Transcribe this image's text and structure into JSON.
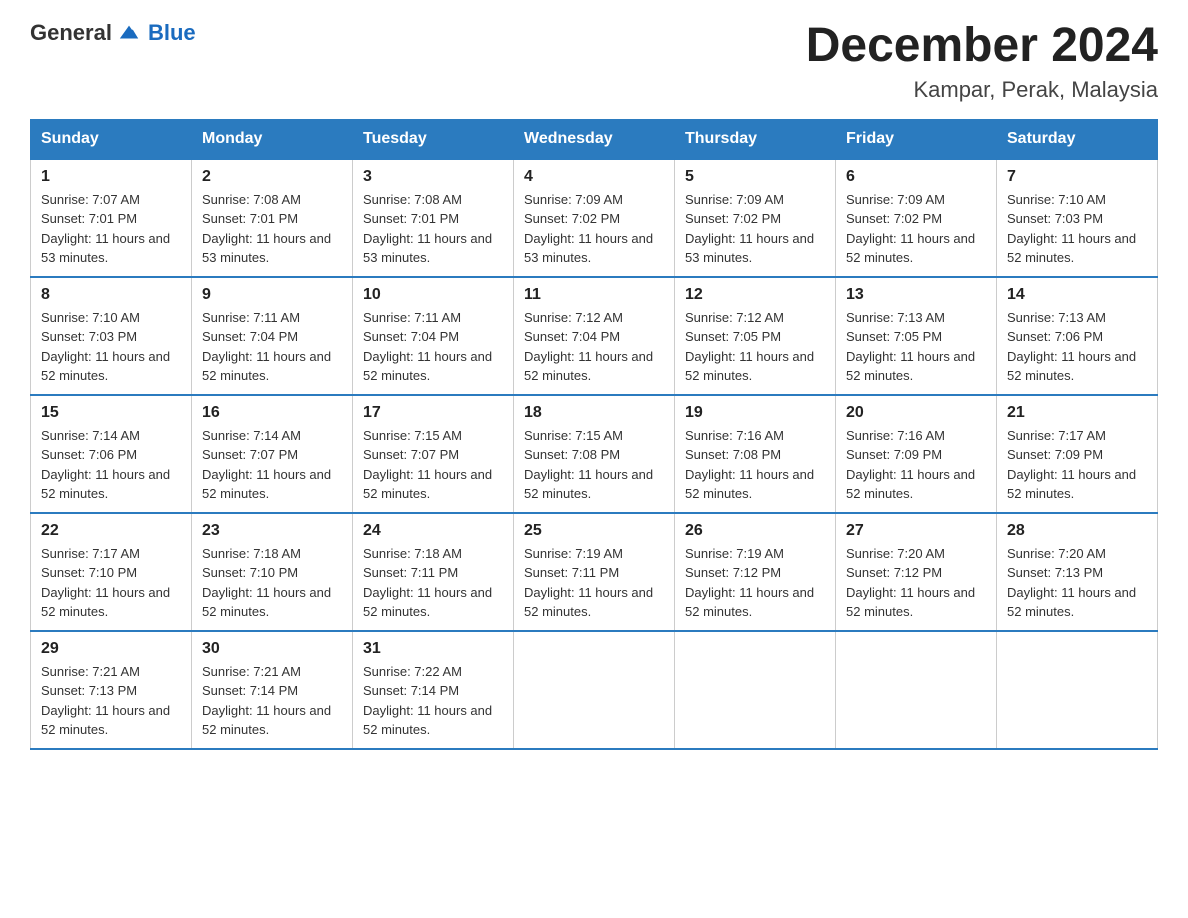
{
  "header": {
    "logo_general": "General",
    "logo_blue": "Blue",
    "month_title": "December 2024",
    "location": "Kampar, Perak, Malaysia"
  },
  "days_of_week": [
    "Sunday",
    "Monday",
    "Tuesday",
    "Wednesday",
    "Thursday",
    "Friday",
    "Saturday"
  ],
  "weeks": [
    [
      {
        "day": "1",
        "sunrise": "7:07 AM",
        "sunset": "7:01 PM",
        "daylight": "11 hours and 53 minutes."
      },
      {
        "day": "2",
        "sunrise": "7:08 AM",
        "sunset": "7:01 PM",
        "daylight": "11 hours and 53 minutes."
      },
      {
        "day": "3",
        "sunrise": "7:08 AM",
        "sunset": "7:01 PM",
        "daylight": "11 hours and 53 minutes."
      },
      {
        "day": "4",
        "sunrise": "7:09 AM",
        "sunset": "7:02 PM",
        "daylight": "11 hours and 53 minutes."
      },
      {
        "day": "5",
        "sunrise": "7:09 AM",
        "sunset": "7:02 PM",
        "daylight": "11 hours and 53 minutes."
      },
      {
        "day": "6",
        "sunrise": "7:09 AM",
        "sunset": "7:02 PM",
        "daylight": "11 hours and 52 minutes."
      },
      {
        "day": "7",
        "sunrise": "7:10 AM",
        "sunset": "7:03 PM",
        "daylight": "11 hours and 52 minutes."
      }
    ],
    [
      {
        "day": "8",
        "sunrise": "7:10 AM",
        "sunset": "7:03 PM",
        "daylight": "11 hours and 52 minutes."
      },
      {
        "day": "9",
        "sunrise": "7:11 AM",
        "sunset": "7:04 PM",
        "daylight": "11 hours and 52 minutes."
      },
      {
        "day": "10",
        "sunrise": "7:11 AM",
        "sunset": "7:04 PM",
        "daylight": "11 hours and 52 minutes."
      },
      {
        "day": "11",
        "sunrise": "7:12 AM",
        "sunset": "7:04 PM",
        "daylight": "11 hours and 52 minutes."
      },
      {
        "day": "12",
        "sunrise": "7:12 AM",
        "sunset": "7:05 PM",
        "daylight": "11 hours and 52 minutes."
      },
      {
        "day": "13",
        "sunrise": "7:13 AM",
        "sunset": "7:05 PM",
        "daylight": "11 hours and 52 minutes."
      },
      {
        "day": "14",
        "sunrise": "7:13 AM",
        "sunset": "7:06 PM",
        "daylight": "11 hours and 52 minutes."
      }
    ],
    [
      {
        "day": "15",
        "sunrise": "7:14 AM",
        "sunset": "7:06 PM",
        "daylight": "11 hours and 52 minutes."
      },
      {
        "day": "16",
        "sunrise": "7:14 AM",
        "sunset": "7:07 PM",
        "daylight": "11 hours and 52 minutes."
      },
      {
        "day": "17",
        "sunrise": "7:15 AM",
        "sunset": "7:07 PM",
        "daylight": "11 hours and 52 minutes."
      },
      {
        "day": "18",
        "sunrise": "7:15 AM",
        "sunset": "7:08 PM",
        "daylight": "11 hours and 52 minutes."
      },
      {
        "day": "19",
        "sunrise": "7:16 AM",
        "sunset": "7:08 PM",
        "daylight": "11 hours and 52 minutes."
      },
      {
        "day": "20",
        "sunrise": "7:16 AM",
        "sunset": "7:09 PM",
        "daylight": "11 hours and 52 minutes."
      },
      {
        "day": "21",
        "sunrise": "7:17 AM",
        "sunset": "7:09 PM",
        "daylight": "11 hours and 52 minutes."
      }
    ],
    [
      {
        "day": "22",
        "sunrise": "7:17 AM",
        "sunset": "7:10 PM",
        "daylight": "11 hours and 52 minutes."
      },
      {
        "day": "23",
        "sunrise": "7:18 AM",
        "sunset": "7:10 PM",
        "daylight": "11 hours and 52 minutes."
      },
      {
        "day": "24",
        "sunrise": "7:18 AM",
        "sunset": "7:11 PM",
        "daylight": "11 hours and 52 minutes."
      },
      {
        "day": "25",
        "sunrise": "7:19 AM",
        "sunset": "7:11 PM",
        "daylight": "11 hours and 52 minutes."
      },
      {
        "day": "26",
        "sunrise": "7:19 AM",
        "sunset": "7:12 PM",
        "daylight": "11 hours and 52 minutes."
      },
      {
        "day": "27",
        "sunrise": "7:20 AM",
        "sunset": "7:12 PM",
        "daylight": "11 hours and 52 minutes."
      },
      {
        "day": "28",
        "sunrise": "7:20 AM",
        "sunset": "7:13 PM",
        "daylight": "11 hours and 52 minutes."
      }
    ],
    [
      {
        "day": "29",
        "sunrise": "7:21 AM",
        "sunset": "7:13 PM",
        "daylight": "11 hours and 52 minutes."
      },
      {
        "day": "30",
        "sunrise": "7:21 AM",
        "sunset": "7:14 PM",
        "daylight": "11 hours and 52 minutes."
      },
      {
        "day": "31",
        "sunrise": "7:22 AM",
        "sunset": "7:14 PM",
        "daylight": "11 hours and 52 minutes."
      },
      null,
      null,
      null,
      null
    ]
  ],
  "labels": {
    "sunrise": "Sunrise:",
    "sunset": "Sunset:",
    "daylight": "Daylight:"
  }
}
